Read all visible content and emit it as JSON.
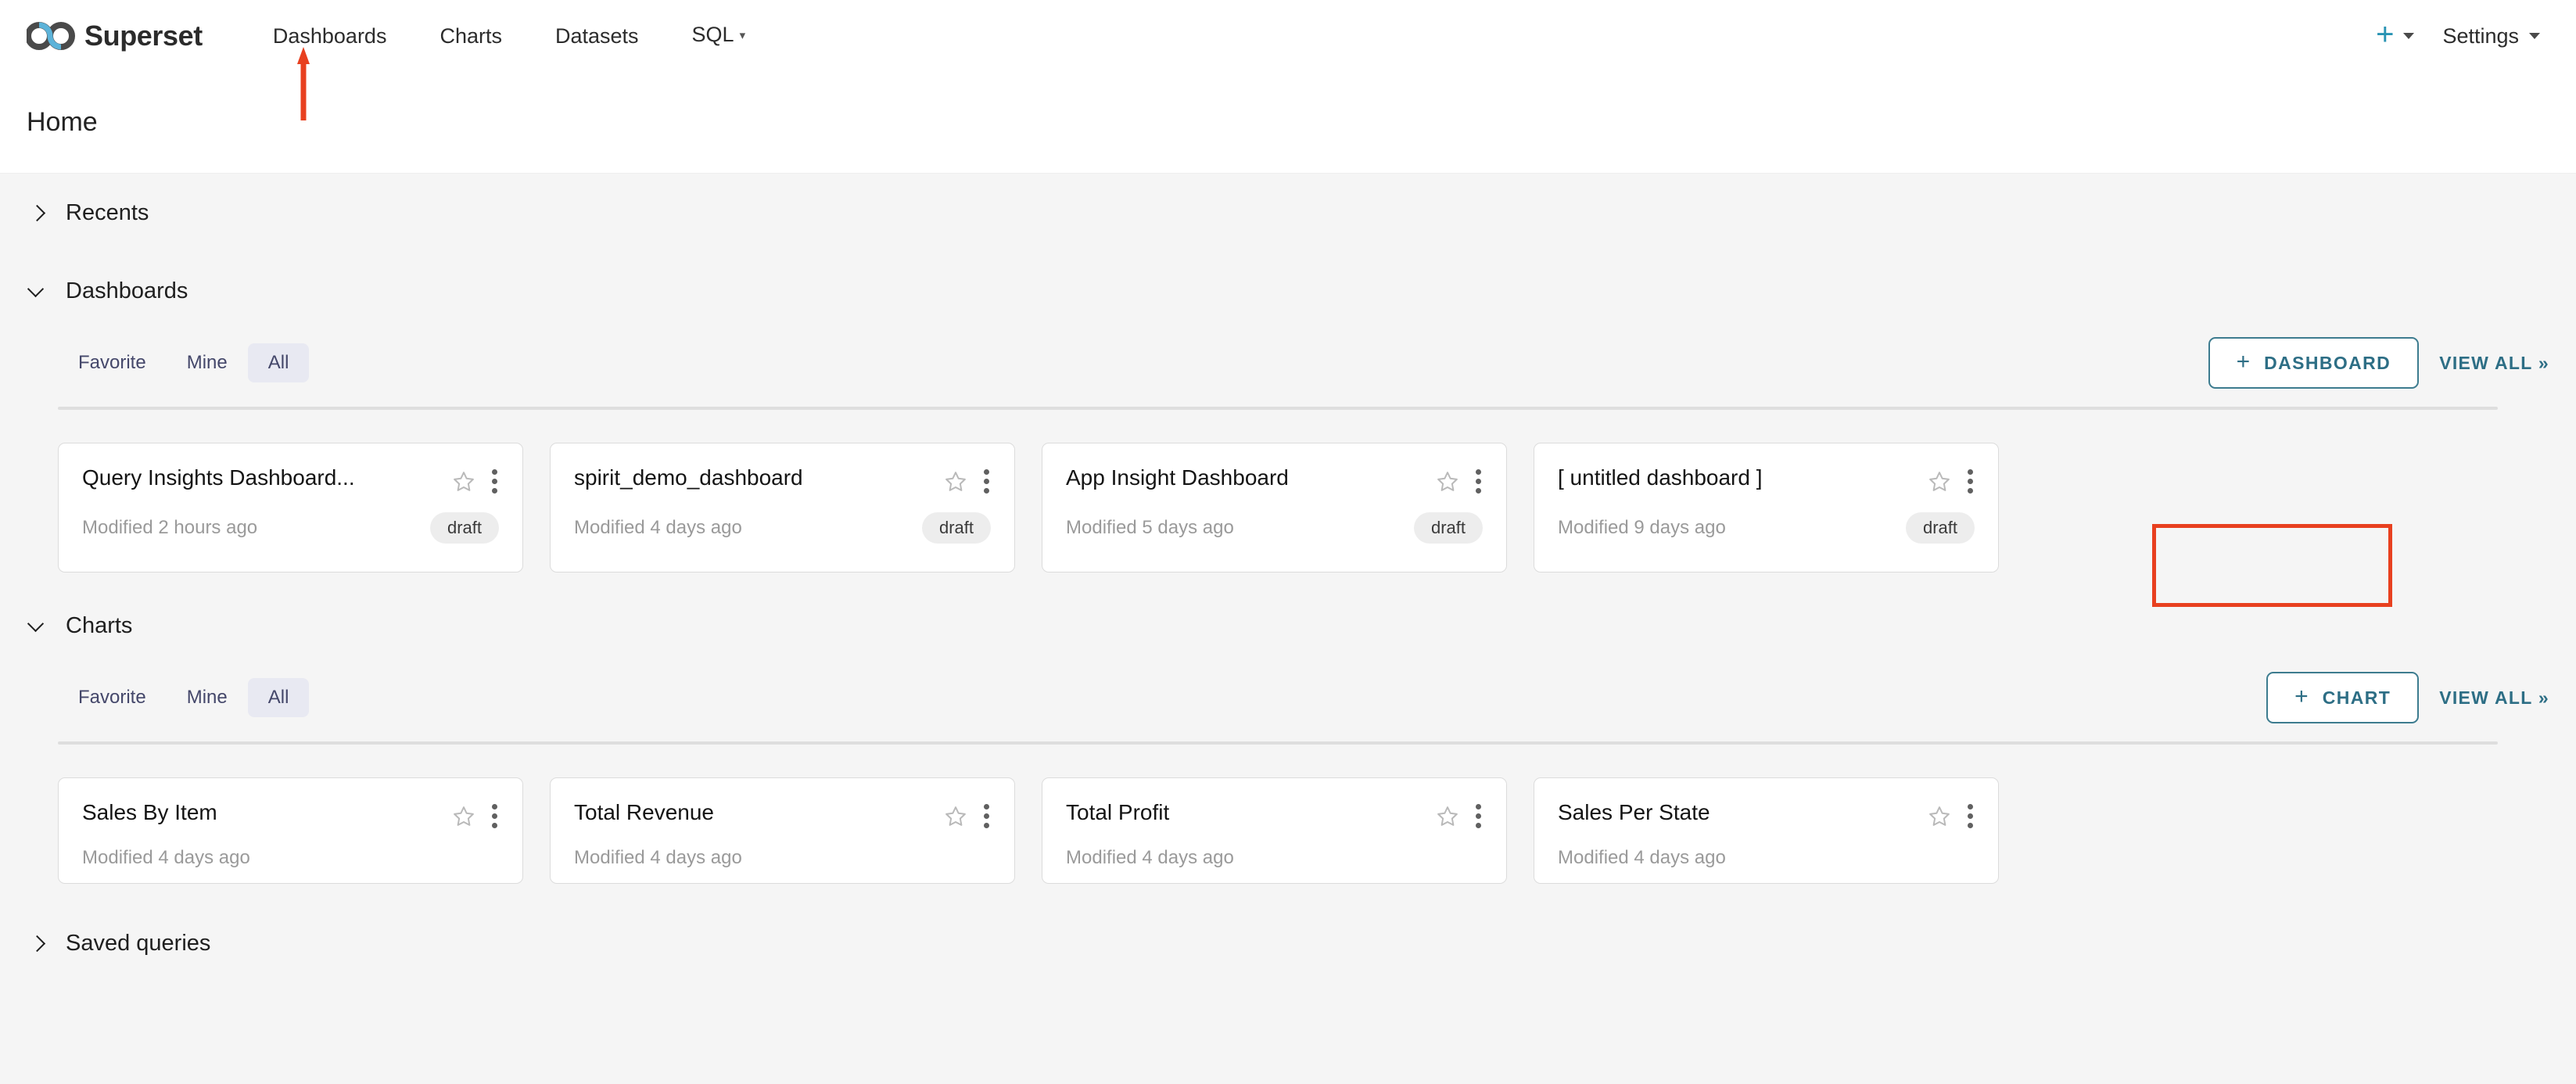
{
  "navbar": {
    "brand": "Superset",
    "logo_icon": "superset-infinity-logo",
    "links": [
      {
        "label": "Dashboards",
        "has_caret": false
      },
      {
        "label": "Charts",
        "has_caret": false
      },
      {
        "label": "Datasets",
        "has_caret": false
      },
      {
        "label": "SQL",
        "has_caret": true
      }
    ],
    "plus_icon": "plus-icon",
    "plus_caret_icon": "caret-down-icon",
    "settings_label": "Settings",
    "settings_caret_icon": "caret-down-icon"
  },
  "page": {
    "title": "Home"
  },
  "annotations": {
    "arrow_color": "#e8401f",
    "box_color": "#e8401f"
  },
  "sections": [
    {
      "id": "recents",
      "title": "Recents",
      "expanded": false,
      "chevron_icon": "chevron-right-icon"
    },
    {
      "id": "dashboards",
      "title": "Dashboards",
      "expanded": true,
      "chevron_icon": "chevron-down-icon",
      "tabs": [
        {
          "label": "Favorite",
          "active": false
        },
        {
          "label": "Mine",
          "active": false
        },
        {
          "label": "All",
          "active": true
        }
      ],
      "create_button": {
        "label": "DASHBOARD",
        "icon": "plus-icon"
      },
      "view_all": "VIEW ALL »",
      "cards": [
        {
          "title": "Query Insights Dashboard...",
          "modified": "Modified 2 hours ago",
          "badge": "draft",
          "star_icon": "star-outline-icon",
          "menu_icon": "more-vertical-icon"
        },
        {
          "title": "spirit_demo_dashboard",
          "modified": "Modified 4 days ago",
          "badge": "draft",
          "star_icon": "star-outline-icon",
          "menu_icon": "more-vertical-icon"
        },
        {
          "title": "App Insight Dashboard",
          "modified": "Modified 5 days ago",
          "badge": "draft",
          "star_icon": "star-outline-icon",
          "menu_icon": "more-vertical-icon"
        },
        {
          "title": "[ untitled dashboard ]",
          "modified": "Modified 9 days ago",
          "badge": "draft",
          "star_icon": "star-outline-icon",
          "menu_icon": "more-vertical-icon"
        }
      ]
    },
    {
      "id": "charts",
      "title": "Charts",
      "expanded": true,
      "chevron_icon": "chevron-down-icon",
      "tabs": [
        {
          "label": "Favorite",
          "active": false
        },
        {
          "label": "Mine",
          "active": false
        },
        {
          "label": "All",
          "active": true
        }
      ],
      "create_button": {
        "label": "CHART",
        "icon": "plus-icon"
      },
      "view_all": "VIEW ALL »",
      "cards": [
        {
          "title": "Sales By Item",
          "modified": "Modified 4 days ago",
          "badge": "",
          "star_icon": "star-outline-icon",
          "menu_icon": "more-vertical-icon"
        },
        {
          "title": "Total Revenue",
          "modified": "Modified 4 days ago",
          "badge": "",
          "star_icon": "star-outline-icon",
          "menu_icon": "more-vertical-icon"
        },
        {
          "title": "Total Profit",
          "modified": "Modified 4 days ago",
          "badge": "",
          "star_icon": "star-outline-icon",
          "menu_icon": "more-vertical-icon"
        },
        {
          "title": "Sales Per State",
          "modified": "Modified 4 days ago",
          "badge": "",
          "star_icon": "star-outline-icon",
          "menu_icon": "more-vertical-icon"
        }
      ]
    },
    {
      "id": "saved-queries",
      "title": "Saved queries",
      "expanded": false,
      "chevron_icon": "chevron-right-icon"
    }
  ],
  "colors": {
    "accent_teal": "#2d6e85",
    "plus_teal": "#2893b3",
    "annotation_red": "#e8401f",
    "tab_active_bg": "#e8e9f2",
    "badge_bg": "#ededed"
  }
}
